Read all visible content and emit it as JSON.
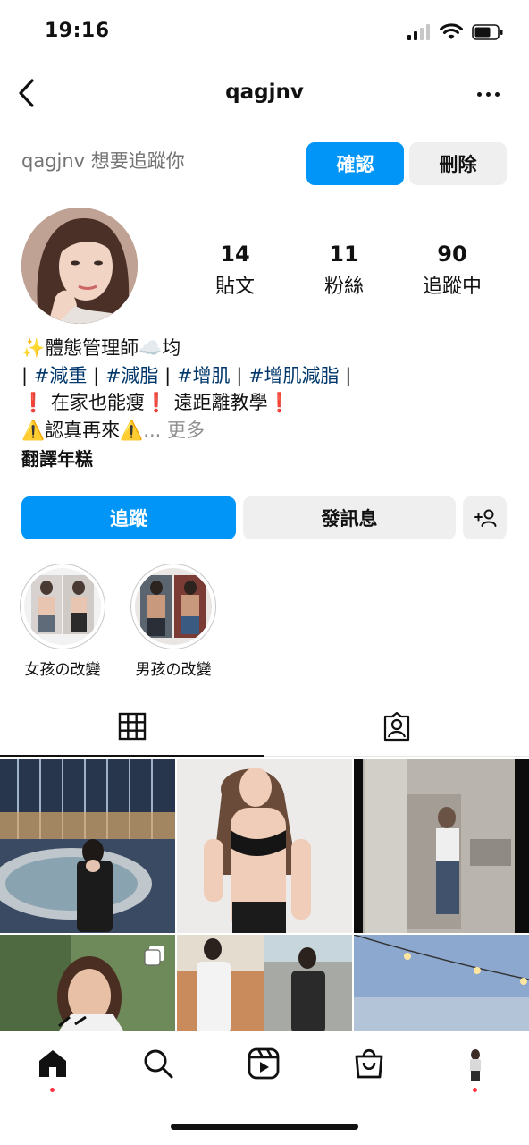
{
  "status_bar": {
    "time": "19:16"
  },
  "nav": {
    "username": "qagjnv"
  },
  "follow_request": {
    "text": "qagjnv 想要追蹤你",
    "confirm_label": "確認",
    "delete_label": "刪除"
  },
  "stats": [
    {
      "value": "14",
      "label": "貼文"
    },
    {
      "value": "11",
      "label": "粉絲"
    },
    {
      "value": "90",
      "label": "追蹤中"
    }
  ],
  "bio": {
    "line1": "✨體態管理師☁️均",
    "line2": {
      "sep": "|",
      "tags": [
        "#減重",
        "#減脂",
        "#增肌",
        "#增肌減脂"
      ]
    },
    "line3": "❗ 在家也能瘦❗ 遠距離教學❗",
    "line4": "⚠️認真再來⚠️",
    "more": "... 更多",
    "translate": "翻譯年糕"
  },
  "actions": {
    "follow_label": "追蹤",
    "message_label": "發訊息"
  },
  "highlights": [
    {
      "label": "女孩の改變"
    },
    {
      "label": "男孩の改變"
    }
  ],
  "icons": {
    "back": "chevron-left-icon",
    "more": "more-horizontal-icon",
    "add_user": "add-user-icon",
    "grid_tab": "grid-icon",
    "tagged_tab": "tagged-icon",
    "home": "home-icon",
    "search": "search-icon",
    "reels": "reels-icon",
    "shop": "shop-icon",
    "profile": "profile-avatar"
  },
  "colors": {
    "accent": "#0095f6",
    "notification_dot": "#ff3040",
    "hashtag": "#00376b"
  }
}
